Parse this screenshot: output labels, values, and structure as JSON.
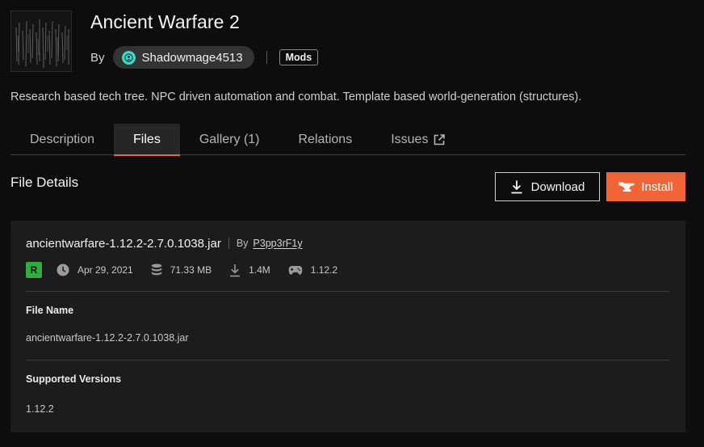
{
  "project": {
    "title": "Ancient Warfare 2",
    "by_label": "By",
    "author": "Shadowmage4513",
    "category": "Mods",
    "summary": "Research based tech tree. NPC driven automation and combat. Template based world-generation (structures)."
  },
  "tabs": [
    {
      "label": "Description",
      "active": false
    },
    {
      "label": "Files",
      "active": true
    },
    {
      "label": "Gallery (1)",
      "active": false
    },
    {
      "label": "Relations",
      "active": false
    },
    {
      "label": "Issues",
      "active": false,
      "icon": "external-link-icon"
    }
  ],
  "file_details": {
    "section_title": "File Details",
    "download_label": "Download",
    "install_label": "Install"
  },
  "file": {
    "name_title": "ancientwarfare-1.12.2-2.7.0.1038.jar",
    "by_label": "By",
    "uploader": "P3pp3rF1y",
    "release_type": "R",
    "date": "Apr 29, 2021",
    "size": "71.33 MB",
    "downloads": "1.4M",
    "game_version": "1.12.2",
    "file_name_label": "File Name",
    "file_name_value": "ancientwarfare-1.12.2-2.7.0.1038.jar",
    "supported_versions_label": "Supported Versions",
    "supported_versions_value": "1.12.2"
  },
  "colors": {
    "accent": "#f16436",
    "release_green": "#2fae3f",
    "author_avatar": "#3fd6c8",
    "background": "#0d0d0d",
    "card": "#1c1c1c"
  }
}
